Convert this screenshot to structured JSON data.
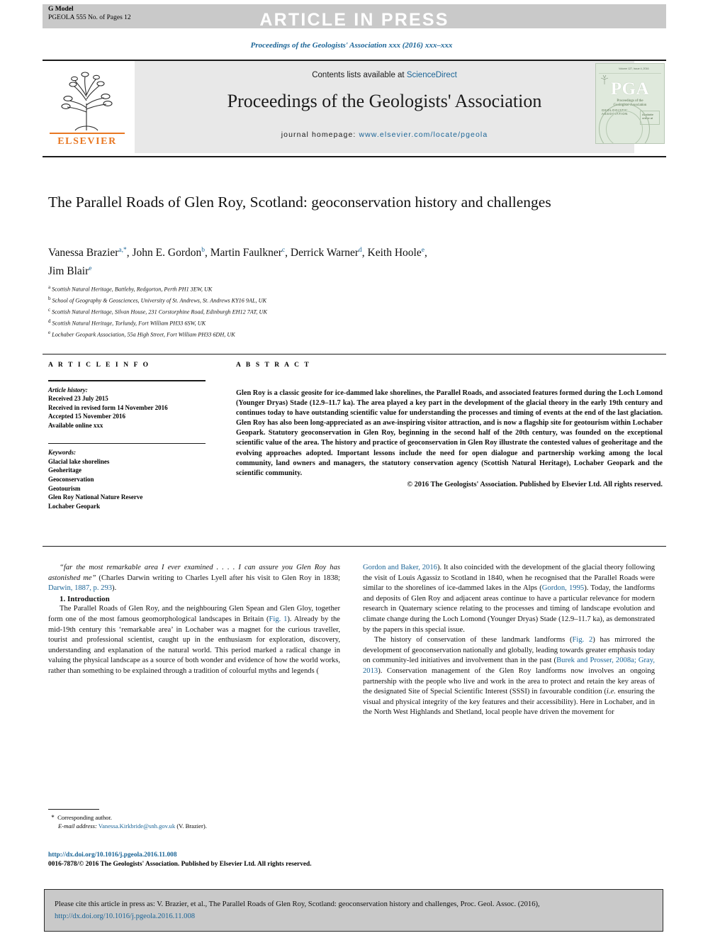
{
  "banner": {
    "g_model": "G Model",
    "model_sub": "PGEOLA 555 No. of Pages 12",
    "article_in_press": "ARTICLE IN PRESS"
  },
  "running_head": "Proceedings of the Geologists' Association xxx (2016) xxx–xxx",
  "masthead": {
    "contents_prefix": "Contents lists available at",
    "contents_link": "ScienceDirect",
    "journal_title": "Proceedings of the Geologists' Association",
    "homepage_label": "journal homepage:",
    "homepage_url": "www.elsevier.com/locate/pgeola",
    "publisher_logo": "ELSEVIER",
    "cover": {
      "acronym": "PGA",
      "subtitle": "Proceedings of the\nGeologists' Association",
      "seal_text": "GEOLOGISTS' ASSOCIATION",
      "topbar": "Volume 127, Issue 4, 2016",
      "badge": "Available online at\nScienceDirect"
    }
  },
  "article": {
    "title": "The Parallel Roads of Glen Roy, Scotland: geoconservation history and challenges",
    "authors": [
      {
        "name": "Vanessa Brazier",
        "marks": "a,*"
      },
      {
        "name": "John E. Gordon",
        "marks": "b"
      },
      {
        "name": "Martin Faulkner",
        "marks": "c"
      },
      {
        "name": "Derrick Warner",
        "marks": "d"
      },
      {
        "name": "Keith Hoole",
        "marks": "e"
      },
      {
        "name": "Jim Blair",
        "marks": "e"
      }
    ],
    "affiliations": [
      {
        "mark": "a",
        "text": "Scottish Natural Heritage, Battleby, Redgorton, Perth PH1 3EW, UK"
      },
      {
        "mark": "b",
        "text": "School of Geography & Geosciences, University of St. Andrews, St. Andrews KY16 9AL, UK"
      },
      {
        "mark": "c",
        "text": "Scottish Natural Heritage, Silvan House, 231 Corstorphine Road, Edinburgh EH12 7AT, UK"
      },
      {
        "mark": "d",
        "text": "Scottish Natural Heritage, Torlundy, Fort William PH33 6SW, UK"
      },
      {
        "mark": "e",
        "text": "Lochaber Geopark Association, 55a High Street, Fort William PH33 6DH, UK"
      }
    ]
  },
  "article_info": {
    "heading": "A R T I C L E   I N F O",
    "history_label": "Article history:",
    "history": [
      "Received 23 July 2015",
      "Received in revised form 14 November 2016",
      "Accepted 15 November 2016",
      "Available online xxx"
    ],
    "keywords_label": "Keywords:",
    "keywords": [
      "Glacial lake shorelines",
      "Geoheritage",
      "Geoconservation",
      "Geotourism",
      "Glen Roy National Nature Reserve",
      "Lochaber Geopark"
    ]
  },
  "abstract": {
    "heading": "A B S T R A C T",
    "text": "Glen Roy is a classic geosite for ice-dammed lake shorelines, the Parallel Roads, and associated features formed during the Loch Lomond (Younger Dryas) Stade (12.9–11.7 ka). The area played a key part in the development of the glacial theory in the early 19th century and continues today to have outstanding scientific value for understanding the processes and timing of events at the end of the last glaciation. Glen Roy has also been long-appreciated as an awe-inspiring visitor attraction, and is now a flagship site for geotourism within Lochaber Geopark. Statutory geoconservation in Glen Roy, beginning in the second half of the 20th century, was founded on the exceptional scientific value of the area. The history and practice of geoconservation in Glen Roy illustrate the contested values of geoheritage and the evolving approaches adopted. Important lessons include the need for open dialogue and partnership working among the local community, land owners and managers, the statutory conservation agency (Scottish Natural Heritage), Lochaber Geopark and the scientific community.",
    "copyright": "© 2016 The Geologists' Association. Published by Elsevier Ltd. All rights reserved."
  },
  "body": {
    "epigraph_quote": "“far the most remarkable area I ever examined . . . . I can assure you Glen Roy has astonished me”",
    "epigraph_rest_1": " (Charles Darwin writing to Charles Lyell after his visit to Glen Roy in 1838; ",
    "epigraph_ref": "Darwin, 1887, p. 293",
    "epigraph_rest_2": ").",
    "section_1_heading": "1. Introduction",
    "para_1_a": "The Parallel Roads of Glen Roy, and the neighbouring Glen Spean and Glen Gloy, together form one of the most famous geomorphological landscapes in Britain (",
    "para_1_ref_1": "Fig. 1",
    "para_1_b": "). Already by the mid-19th century this ‘remarkable area’ in Lochaber was a magnet for the curious traveller, tourist and professional scientist, caught up in the enthusiasm for exploration, discovery, understanding and explanation of the natural world. This period marked a radical change in valuing the physical landscape as a source of both wonder and evidence of how the world works, rather than something to be explained through a tradition of colourful myths and legends (",
    "para_1_ref_2": "Gordon and Baker, 2016",
    "para_1_c": "). It also coincided with the development of the glacial theory following the visit of Louis Agassiz to Scotland in 1840, when he recognised that the Parallel Roads were similar to the shorelines of ice-dammed lakes in the Alps (",
    "para_1_ref_3": "Gordon, 1995",
    "para_1_d": "). Today, the landforms and deposits of Glen Roy and adjacent areas continue to have a particular relevance for modern research in Quaternary science relating to the processes and timing of landscape evolution and climate change during the Loch Lomond (Younger Dryas) Stade (12.9–11.7 ka), as demonstrated by the papers in this special issue.",
    "para_2_a": "The history of conservation of these landmark landforms (",
    "para_2_ref_1": "Fig. 2",
    "para_2_b": ") has mirrored the development of geoconservation nationally and globally, leading towards greater emphasis today on community-led initiatives and involvement than in the past (",
    "para_2_ref_2": "Burek and Prosser, 2008a; Gray, 2013",
    "para_2_c": "). Conservation management of the Glen Roy landforms now involves an ongoing partnership with the people who live and work in the area to protect and retain the key areas of the designated Site of Special Scientific Interest (SSSI) in favourable condition (",
    "para_2_italic": "i.e.",
    "para_2_d": " ensuring the visual and physical integrity of the key features and their accessibility). Here in Lochaber, and in the North West Highlands and Shetland, local people have driven the movement for"
  },
  "footnote": {
    "star": "*",
    "corresponding": "Corresponding author.",
    "email_label": "E-mail address:",
    "email": "Vanessa.Kirkbride@snh.gov.uk",
    "email_suffix": "(V. Brazier)."
  },
  "footer": {
    "doi": "http://dx.doi.org/10.1016/j.pgeola.2016.11.008",
    "issn_line": "0016-7878/© 2016 The Geologists' Association. Published by Elsevier Ltd. All rights reserved."
  },
  "citation_box": {
    "prefix": "Please cite this article in press as: V. Brazier, et al., The Parallel Roads of Glen Roy, Scotland: geoconservation history and challenges, Proc. Geol. Assoc. (2016), ",
    "link": "http://dx.doi.org/10.1016/j.pgeola.2016.11.008"
  },
  "colors": {
    "link": "#1a6496",
    "banner_grey": "#c9c9c9",
    "mast_grey": "#e8e8e8",
    "elsevier_orange": "#e87722",
    "cover_green": "#dfe9dc"
  }
}
